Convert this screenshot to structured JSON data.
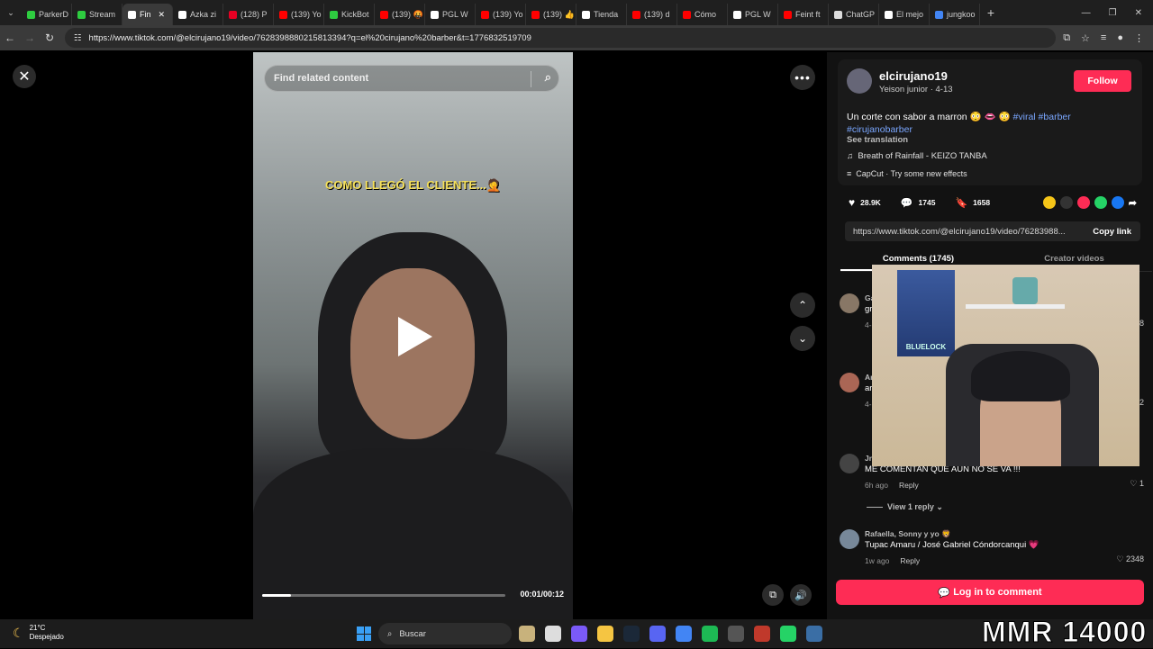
{
  "browser": {
    "tabs": [
      {
        "label": "ParkerD",
        "color": "#2ecc40"
      },
      {
        "label": "Stream",
        "color": "#2ecc40"
      },
      {
        "label": "Fin",
        "color": "#ffffff",
        "active": true
      },
      {
        "label": "Azka zi",
        "color": "#ffffff"
      },
      {
        "label": "(128) P",
        "color": "#e60023"
      },
      {
        "label": "(139) Yo",
        "color": "#ff0000"
      },
      {
        "label": "KickBot",
        "color": "#2ecc40"
      },
      {
        "label": "(139) 🤬",
        "color": "#ff0000"
      },
      {
        "label": "PGL W",
        "color": "#ffffff"
      },
      {
        "label": "(139) Yo",
        "color": "#ff0000"
      },
      {
        "label": "(139) 👍",
        "color": "#ff0000"
      },
      {
        "label": "Tienda",
        "color": "#ffffff"
      },
      {
        "label": "(139) d",
        "color": "#ff0000"
      },
      {
        "label": "Cómo",
        "color": "#ff0000"
      },
      {
        "label": "PGL W",
        "color": "#ffffff"
      },
      {
        "label": "Feint ft",
        "color": "#ff0000"
      },
      {
        "label": "ChatGP",
        "color": "#dddddd"
      },
      {
        "label": "El mejo",
        "color": "#ffffff"
      },
      {
        "label": "jungkoo",
        "color": "#4285f4"
      }
    ],
    "new_tab": "+",
    "url": "https://www.tiktok.com/@elcirujano19/video/7628398880215813394?q=el%20cirujano%20barber&t=1776832519709"
  },
  "video": {
    "search_placeholder": "Find related content",
    "caption": "COMO LLEGÓ EL CLIENTE...🤦",
    "progress": 0.12,
    "time": "00:01/00:12"
  },
  "author": {
    "username": "elcirujano19",
    "subline": "Yeison junior · 4-13",
    "follow_label": "Follow",
    "desc_text": "Un corte con sabor a marron 😳 👄 😳 ",
    "hashtags": "#viral #barber",
    "hashtag2": "#cirujanobarber",
    "see_translation": "See translation",
    "music": "Breath of Rainfall - KEIZO TANBA",
    "effect": "CapCut · Try some new effects"
  },
  "stats": {
    "likes": "28.9K",
    "comments": "1745",
    "saves": "1658"
  },
  "link": {
    "url": "https://www.tiktok.com/@elcirujano19/video/76283988...",
    "copy_label": "Copy link"
  },
  "panel_tabs": {
    "comments": "Comments (1745)",
    "creator": "Creator videos"
  },
  "comments": [
    {
      "name": "Ga",
      "text": "gr",
      "meta": "4-",
      "likes": "8"
    },
    {
      "name": "Ar",
      "text": "ar",
      "meta": "4-",
      "likes": "2"
    },
    {
      "name": "Jr",
      "text": "ME COMENTAN QUE AUN NO SE VA !!!",
      "meta": "6h ago",
      "reply": "Reply",
      "likes": "1"
    },
    {
      "name": "Rafaella, Sonny y yo 🦁",
      "text": "Tupac Amaru / José Gabriel Cóndorcanqui 💗",
      "meta": "1w ago",
      "reply": "Reply",
      "likes": "2348"
    }
  ],
  "view_replies": "View 1 reply",
  "login_label": "Log in to comment",
  "webcam": {
    "poster_text": "BLUELOCK"
  },
  "taskbar": {
    "temp": "21°C",
    "weather": "Despejado",
    "search": "Buscar"
  },
  "overlay_text": "MMR 14000"
}
